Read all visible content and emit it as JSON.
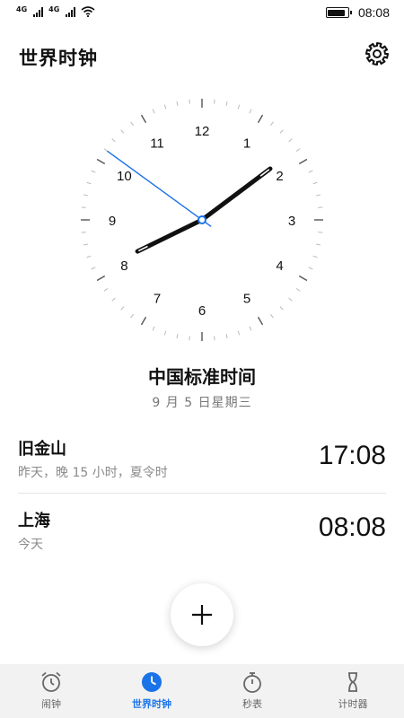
{
  "status_bar": {
    "network_1": "4G",
    "network_2": "4G",
    "time": "08:08",
    "battery_level": 0.9
  },
  "header": {
    "title": "世界时钟",
    "settings_icon": "gear-icon"
  },
  "clock": {
    "numerals": [
      "12",
      "1",
      "2",
      "3",
      "4",
      "5",
      "6",
      "7",
      "8",
      "9",
      "10",
      "11"
    ],
    "hour": 8,
    "minute": 8,
    "second": 51,
    "accent_color": "#1a73e8"
  },
  "local_timezone": {
    "name": "中国标准时间",
    "date": "9 月 5 日星期三"
  },
  "cities": [
    {
      "name": "旧金山",
      "detail": "昨天，晚 15 小时，夏令时",
      "time": "17:08"
    },
    {
      "name": "上海",
      "detail": "今天",
      "time": "08:08"
    }
  ],
  "fab": {
    "icon": "plus-icon"
  },
  "bottom_nav": {
    "items": [
      {
        "label": "闹钟",
        "icon": "alarm-icon"
      },
      {
        "label": "世界时钟",
        "icon": "world-clock-icon"
      },
      {
        "label": "秒表",
        "icon": "stopwatch-icon"
      },
      {
        "label": "计时器",
        "icon": "timer-icon"
      }
    ],
    "active_color": "#1a73e8"
  }
}
